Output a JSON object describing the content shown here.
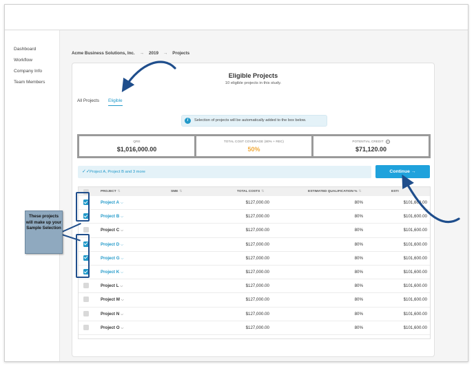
{
  "sidebar": {
    "items": [
      {
        "label": "Dashboard"
      },
      {
        "label": "Workflow"
      },
      {
        "label": "Company Info"
      },
      {
        "label": "Team Members"
      }
    ]
  },
  "breadcrumb": {
    "company": "Acme Business Solutions, Inc.",
    "year": "2019",
    "page": "Projects",
    "separator": "→"
  },
  "card": {
    "title": "Eligible Projects",
    "subtitle": "10 eligible projects in this study."
  },
  "tabs": [
    {
      "label": "All Projects",
      "active": false
    },
    {
      "label": "Eligible",
      "active": true
    }
  ],
  "info_banner": {
    "icon": "i",
    "text": "Selection of projects will be automatically added to the box below."
  },
  "stats": [
    {
      "label": "QRE",
      "value": "$1,016,000.00",
      "help": false
    },
    {
      "label": "TOTAL COST COVERAGE (80% + REC)",
      "value": "50%",
      "help": false
    },
    {
      "label": "POTENTIAL CREDIT",
      "value": "$71,120.00",
      "help": true
    }
  ],
  "selection_bar": {
    "text": "Project A, Project B and 3 more"
  },
  "continue_button": {
    "label": "Continue →"
  },
  "table": {
    "headers": {
      "project": "PROJECT",
      "sme": "SME",
      "total_costs": "TOTAL COSTS",
      "estimated_qualification": "ESTIMATED QUALIFICATION %",
      "estimated_qre": "ESTI"
    },
    "sort_glyph": "⇅",
    "rows": [
      {
        "project": "Project A",
        "selected": true,
        "total_costs": "$127,000.00",
        "qualification": "80%",
        "qre": "$101,600.00"
      },
      {
        "project": "Project B",
        "selected": true,
        "total_costs": "$127,000.00",
        "qualification": "80%",
        "qre": "$101,600.00"
      },
      {
        "project": "Project C",
        "selected": false,
        "total_costs": "$127,000.00",
        "qualification": "80%",
        "qre": "$101,600.00"
      },
      {
        "project": "Project D",
        "selected": true,
        "total_costs": "$127,000.00",
        "qualification": "80%",
        "qre": "$101,600.00"
      },
      {
        "project": "Project G",
        "selected": true,
        "total_costs": "$127,000.00",
        "qualification": "80%",
        "qre": "$101,600.00"
      },
      {
        "project": "Project K",
        "selected": true,
        "total_costs": "$127,000.00",
        "qualification": "80%",
        "qre": "$101,600.00"
      },
      {
        "project": "Project L",
        "selected": false,
        "total_costs": "$127,000.00",
        "qualification": "80%",
        "qre": "$101,600.00"
      },
      {
        "project": "Project M",
        "selected": false,
        "total_costs": "$127,000.00",
        "qualification": "80%",
        "qre": "$101,600.00"
      },
      {
        "project": "Project N",
        "selected": false,
        "total_costs": "$127,000.00",
        "qualification": "80%",
        "qre": "$101,600.00"
      },
      {
        "project": "Project O",
        "selected": false,
        "total_costs": "$127,000.00",
        "qualification": "80%",
        "qre": "$101,600.00"
      }
    ]
  },
  "annotation": {
    "callout_text": "These projects will make up your Sample Selection"
  },
  "colors": {
    "accent": "#2199c9",
    "button": "#1fa2dc",
    "annotation": "#1f4e8c",
    "orange": "#f0a93b",
    "callout": "#8fa9bf"
  }
}
